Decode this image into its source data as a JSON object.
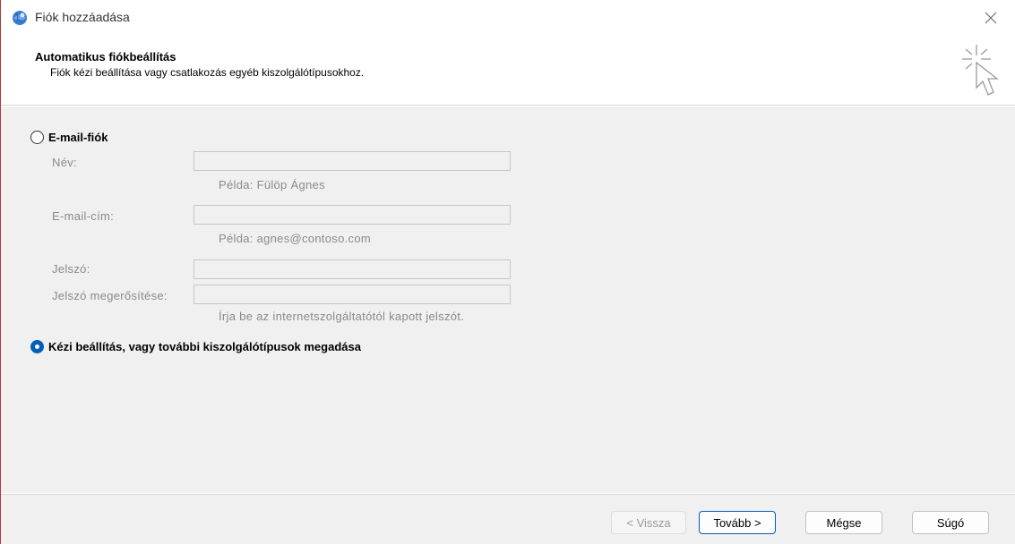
{
  "window": {
    "title": "Fiók hozzáadása"
  },
  "header": {
    "title": "Automatikus fiókbeállítás",
    "subtitle": "Fiók kézi beállítása vagy csatlakozás egyéb kiszolgálótípusokhoz."
  },
  "email_account": {
    "option_label": "E-mail-fiók",
    "selected": false,
    "name_label": "Név:",
    "name_value": "",
    "name_hint": "Példa: Fülöp Ágnes",
    "email_label": "E-mail-cím:",
    "email_value": "",
    "email_hint": "Példa: agnes@contoso.com",
    "password_label": "Jelszó:",
    "password_value": "",
    "confirm_label": "Jelszó megerősítése:",
    "confirm_value": "",
    "password_hint": "Írja be az internetszolgáltatótól kapott jelszót."
  },
  "manual_setup": {
    "option_label": "Kézi beállítás, vagy további kiszolgálótípusok megadása",
    "selected": true
  },
  "footer": {
    "back_label": "< Vissza",
    "next_label": "Tovább >",
    "cancel_label": "Mégse",
    "help_label": "Súgó"
  },
  "icons": {
    "app": "outlook-globe-icon",
    "close": "close-icon",
    "header": "cursor-click-sparkle-icon"
  },
  "colors": {
    "accent": "#005fb8",
    "content_bg": "#f0f0f0",
    "disabled_text": "#8a8a8a"
  }
}
